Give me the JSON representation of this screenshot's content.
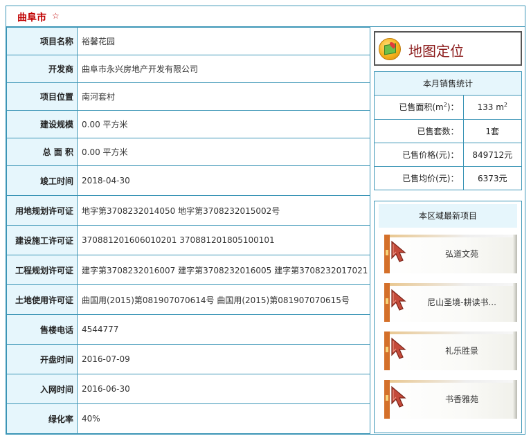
{
  "header": {
    "city": "曲阜市",
    "star": "☆"
  },
  "info_rows": [
    {
      "label": "项目名称",
      "value": "裕馨花园"
    },
    {
      "label": "开发商",
      "value": "曲阜市永兴房地产开发有限公司"
    },
    {
      "label": "项目位置",
      "value": "南河套村"
    },
    {
      "label": "建设规模",
      "value": "0.00 平方米"
    },
    {
      "label": "总 面 积",
      "value": "0.00 平方米"
    },
    {
      "label": "竣工时间",
      "value": "2018-04-30"
    },
    {
      "label": "用地规划许可证",
      "value": "地字第3708232014050 地字第3708232015002号"
    },
    {
      "label": "建设施工许可证",
      "value": "370881201606010201 370881201805100101"
    },
    {
      "label": "工程规划许可证",
      "value": "建字第3708232016007 建字第3708232016005 建字第3708232017021"
    },
    {
      "label": "土地使用许可证",
      "value": "曲国用(2015)第081907070614号 曲国用(2015)第081907070615号"
    },
    {
      "label": "售楼电话",
      "value": "4544777"
    },
    {
      "label": "开盘时间",
      "value": "2016-07-09"
    },
    {
      "label": "入网时间",
      "value": "2016-06-30"
    },
    {
      "label": "绿化率",
      "value": "40%"
    }
  ],
  "map_button": {
    "label": "地图定位",
    "icon": "map-location-icon"
  },
  "sales": {
    "title": "本月销售统计",
    "area_label": "已售面积(m",
    "area_label_sup": "2",
    "area_label_tail": ")：",
    "area_value": "133 m",
    "area_value_sup": "2",
    "rows": [
      {
        "label": "已售套数：",
        "value": "1套"
      },
      {
        "label": "已售价格(元)：",
        "value": "849712元"
      },
      {
        "label": "已售均价(元)：",
        "value": "6373元"
      }
    ]
  },
  "recent": {
    "title": "本区域最新项目",
    "items": [
      {
        "name": "弘道文苑"
      },
      {
        "name": "尼山圣境-耕读书..."
      },
      {
        "name": "礼乐胜景"
      },
      {
        "name": "书香雅苑"
      }
    ]
  },
  "colors": {
    "border": "#3b95b6",
    "label_bg": "#e6f6fc",
    "city_red": "#c00000",
    "map_text": "#8b1a1a"
  }
}
